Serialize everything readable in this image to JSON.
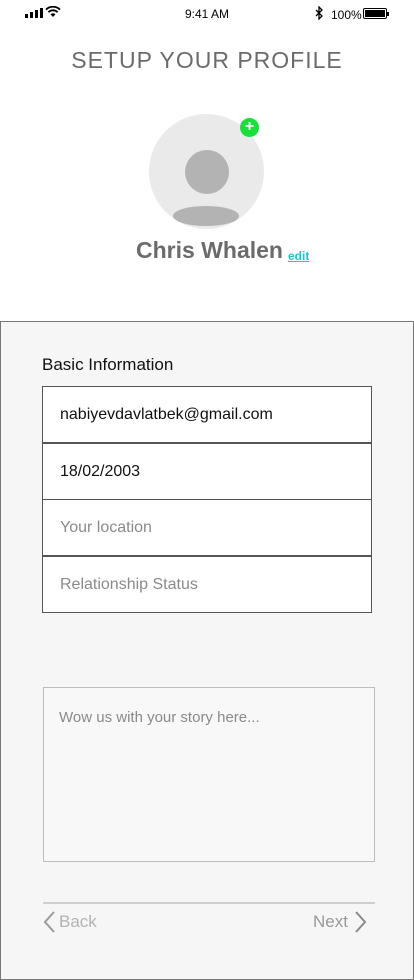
{
  "status_bar": {
    "time": "9:41 AM",
    "battery_percent": "100%",
    "icons": [
      "signal-icon",
      "wifi-icon",
      "bluetooth-icon",
      "battery-icon"
    ]
  },
  "header": {
    "title": "SETUP YOUR PROFILE"
  },
  "profile": {
    "name": "Chris Whalen",
    "edit_label": "edit",
    "avatar_icon": "user-avatar-icon",
    "add_photo_icon": "plus-icon",
    "add_photo_symbol": "+",
    "add_photo_color": "#18e03a"
  },
  "form": {
    "section_label": "Basic Information",
    "email": {
      "value": "nabiyevdavlatbek@gmail.com"
    },
    "birth_date": {
      "value": "18/02/2003"
    },
    "location": {
      "placeholder": "Your location"
    },
    "relationship": {
      "placeholder": "Relationship Status"
    },
    "story": {
      "placeholder": "Wow us with your story here..."
    }
  },
  "navigation": {
    "back_label": "Back",
    "next_label": "Next"
  },
  "colors": {
    "accent_link": "#21c2d6",
    "title_gray": "#6b6b6b",
    "panel_bg": "#f6f6f6"
  }
}
